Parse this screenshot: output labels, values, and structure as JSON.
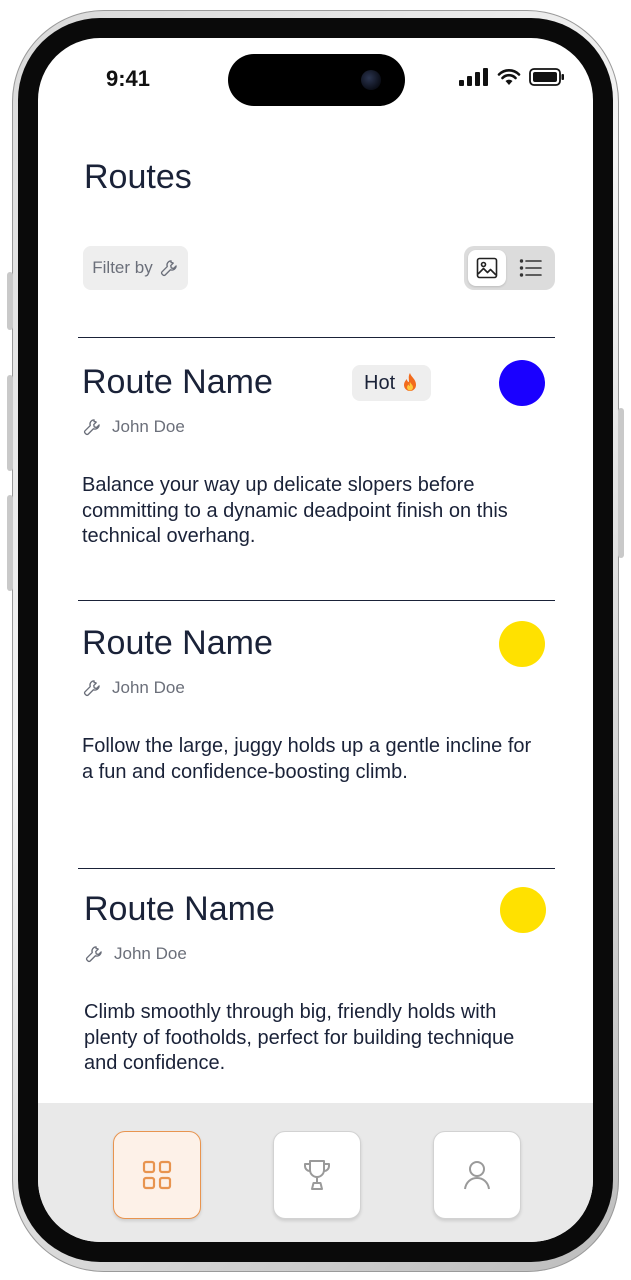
{
  "status": {
    "time": "9:41"
  },
  "header": {
    "title": "Routes"
  },
  "filter": {
    "label": "Filter by"
  },
  "view_toggle": {
    "selected": "image-view",
    "options": [
      "image-view",
      "list-view"
    ]
  },
  "routes": [
    {
      "name": "Route Name",
      "badge": "Hot",
      "badge_icon": "fire-emoji",
      "color": "#1a00ff",
      "author": "John Doe",
      "description": "Balance your way up delicate slopers before committing to a dynamic deadpoint finish on this technical overhang."
    },
    {
      "name": "Route Name",
      "color": "#ffe100",
      "author": "John Doe",
      "description": "Follow the large, juggy holds up a gentle incline for a fun and confidence-boosting climb."
    },
    {
      "name": "Route Name",
      "color": "#ffe100",
      "author": "John Doe",
      "description": "Climb smoothly through big, friendly holds with plenty of footholds, perfect for building technique and confidence."
    }
  ],
  "tabbar": {
    "tabs": [
      {
        "icon": "grid-icon",
        "active": true
      },
      {
        "icon": "trophy-icon",
        "active": false
      },
      {
        "icon": "user-icon",
        "active": false
      }
    ],
    "accent": "#e8944f"
  }
}
